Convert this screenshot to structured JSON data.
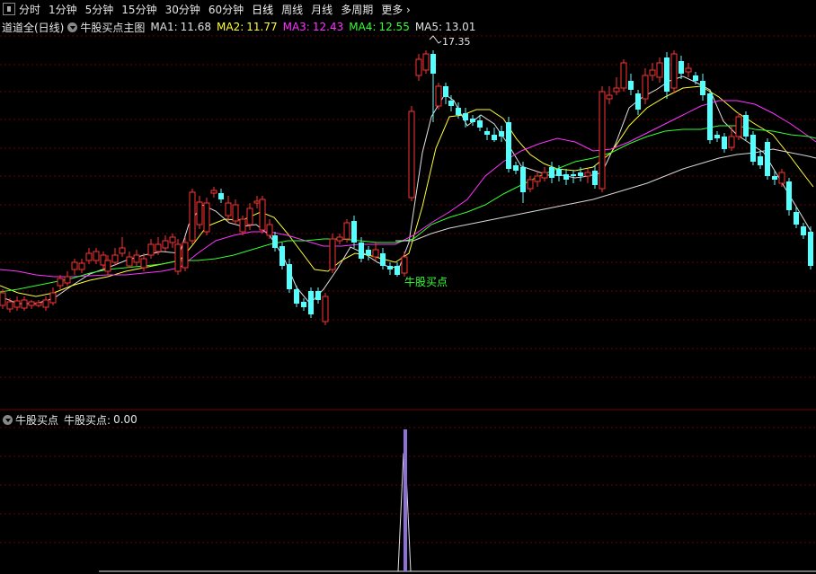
{
  "toolbar": {
    "periods": [
      "分时",
      "1分钟",
      "5分钟",
      "15分钟",
      "30分钟",
      "60分钟",
      "日线",
      "周线",
      "月线",
      "多周期"
    ],
    "active": "日线",
    "more": "更多"
  },
  "legend": {
    "stock": "道道全(日线)",
    "indicator": "牛股买点主图",
    "ma": [
      {
        "label": "MA1:",
        "value": "11.68",
        "color": "#e0e0e0"
      },
      {
        "label": "MA2:",
        "value": "11.77",
        "color": "#ffff33"
      },
      {
        "label": "MA3:",
        "value": "12.43",
        "color": "#ff33ff"
      },
      {
        "label": "MA4:",
        "value": "12.55",
        "color": "#33ff33"
      },
      {
        "label": "MA5:",
        "value": "13.01",
        "color": "#e0e0e0"
      }
    ]
  },
  "annotations": {
    "high_price": "17.35",
    "signal_text": "牛股买点"
  },
  "sub_panel": {
    "name": "牛股买点",
    "series_label": "牛股买点:",
    "value": "0.00"
  },
  "colors": {
    "up": "#ff3333",
    "down": "#54ffff",
    "grid": "#6e0000",
    "signal": "#8c70d8",
    "text_green": "#33ff33"
  }
}
